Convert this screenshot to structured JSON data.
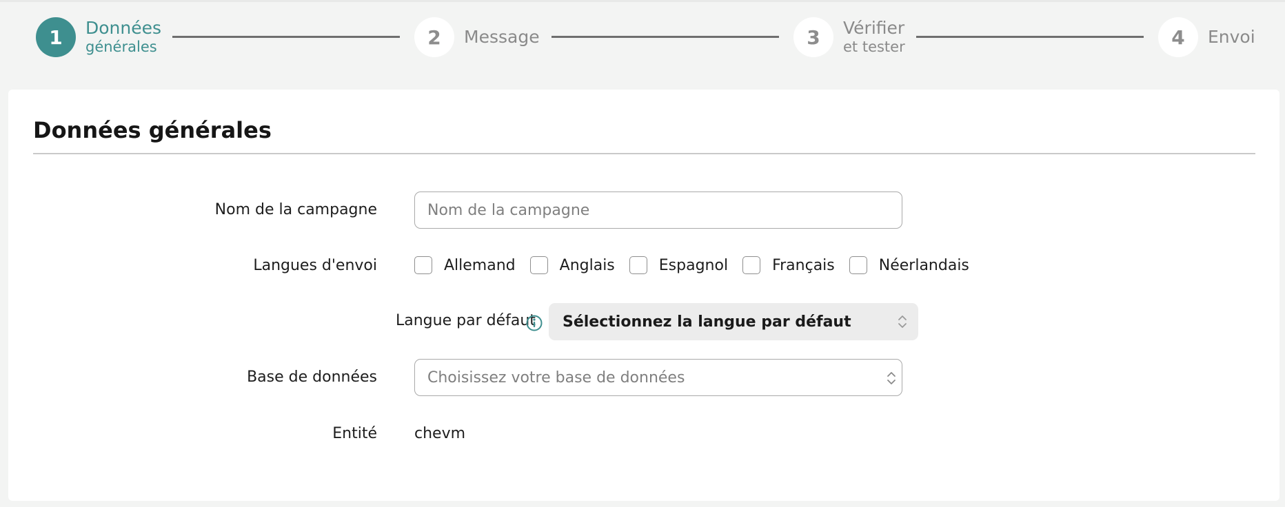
{
  "stepper": {
    "steps": [
      {
        "number": "1",
        "label": "Données",
        "sub": "générales",
        "state": "active"
      },
      {
        "number": "2",
        "label": "Message",
        "sub": "",
        "state": "inactive"
      },
      {
        "number": "3",
        "label": "Vérifier",
        "sub": "et tester",
        "state": "inactive"
      },
      {
        "number": "4",
        "label": "Envoi",
        "sub": "",
        "state": "inactive"
      }
    ]
  },
  "form": {
    "section_title": "Données générales",
    "campaign_name": {
      "label": "Nom de la campagne",
      "value": "",
      "placeholder": "Nom de la campagne"
    },
    "languages": {
      "label": "Langues d'envoi",
      "options": [
        {
          "label": "Allemand",
          "checked": false
        },
        {
          "label": "Anglais",
          "checked": false
        },
        {
          "label": "Espagnol",
          "checked": false
        },
        {
          "label": "Français",
          "checked": false
        },
        {
          "label": "Néerlandais",
          "checked": false
        }
      ]
    },
    "default_language": {
      "label": "Langue par défaut",
      "info_icon": "info-circle-icon",
      "selected": "Sélectionnez la langue par défaut",
      "icon": "chevron-up-down-icon"
    },
    "database": {
      "label": "Base de données",
      "selected": "Choisissez votre base de données",
      "icon": "chevron-up-down-icon"
    },
    "entity": {
      "label": "Entité",
      "value": "chevm"
    }
  },
  "colors": {
    "accent": "#3e8f8f",
    "background": "#f3f4f3",
    "card": "#ffffff",
    "inactive_step": "#8a8a8a",
    "select_gray": "#ececec"
  }
}
